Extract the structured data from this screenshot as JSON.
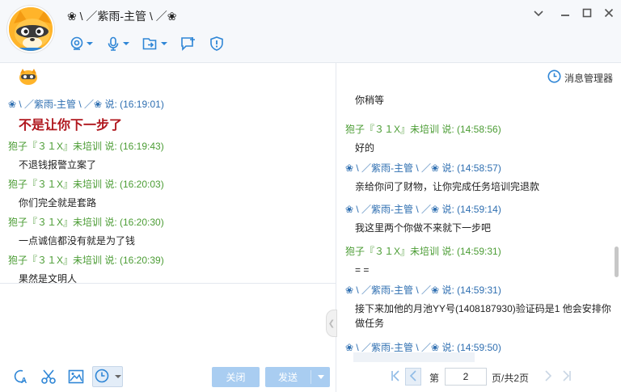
{
  "window": {
    "title": "❀ \\ ／紫雨-主管 \\ ／❀"
  },
  "toolbar": {
    "icons": [
      "video-call-icon",
      "voice-call-icon",
      "send-file-icon",
      "add-group-icon",
      "report-icon"
    ]
  },
  "colors": {
    "accent": "#2f86d6",
    "sender_blue": "#2f6fb1",
    "sender_green": "#4b9c34",
    "highlight_red": "#b0181f",
    "button_disabled": "#a9cdf1"
  },
  "left_chat": {
    "messages": [
      {
        "header": "❀ \\ ／紫雨-主管 \\ ／❀ 说: (16:19:01)",
        "body": "不是让你下一步了",
        "sender": "blue"
      },
      {
        "header": "狍子『３１X』未培训 说: (16:19:43)",
        "body": "不退钱报警立案了",
        "sender": "green"
      },
      {
        "header": "狍子『３１X』未培训 说: (16:20:03)",
        "body": "你们完全就是套路",
        "sender": "green"
      },
      {
        "header": "狍子『３１X』未培训 说: (16:20:30)",
        "body": "一点诚信都没有就是为了钱",
        "sender": "green"
      },
      {
        "header": "狍子『３１X』未培训 说: (16:20:39)",
        "body": "果然是文明人",
        "sender": "green"
      }
    ]
  },
  "input_toolbar": {
    "icons": [
      "font-icon",
      "screenshot-icon",
      "image-icon",
      "history-clock-icon"
    ]
  },
  "buttons": {
    "close_label": "关闭",
    "send_label": "发送"
  },
  "right_panel": {
    "message_manager_label": "消息管理器",
    "messages": [
      {
        "header": "",
        "body": "你稍等",
        "sender": "none"
      },
      {
        "header": "狍子『３１X』未培训 说: (14:58:56)",
        "body": "好的",
        "sender": "green"
      },
      {
        "header": "❀ \\ ／紫雨-主管 \\ ／❀ 说: (14:58:57)",
        "body": "亲给你问了财物，让你完成任务培训完退款",
        "sender": "blue"
      },
      {
        "header": "❀ \\ ／紫雨-主管 \\ ／❀ 说: (14:59:14)",
        "body": "我这里两个你做不来就下一步吧",
        "sender": "blue"
      },
      {
        "header": "狍子『３１X』未培训 说: (14:59:31)",
        "body": "= =",
        "sender": "green"
      },
      {
        "header": "❀ \\ ／紫雨-主管 \\ ／❀ 说: (14:59:31)",
        "body": "接下来加他的月池YY号(1408187930)验证码是1 他会安排你做任务",
        "sender": "blue"
      },
      {
        "header": "❀ \\ ／紫雨-主管 \\ ／❀ 说: (14:59:50)",
        "body": "",
        "sender": "blue"
      }
    ],
    "pager": {
      "page_prefix": "第",
      "current_page": "2",
      "page_suffix": "页/共2页"
    }
  }
}
